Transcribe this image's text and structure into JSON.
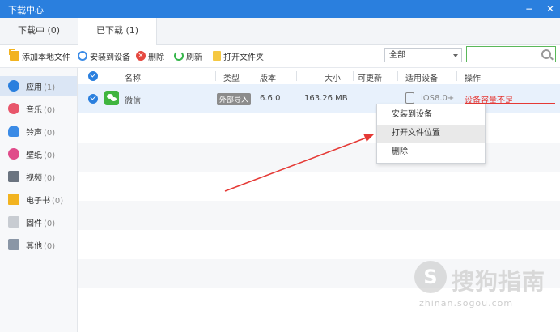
{
  "window": {
    "title": "下载中心",
    "minimize": "−",
    "close": "✕"
  },
  "tabs": [
    {
      "label": "下载中 (0)"
    },
    {
      "label": "已下载 (1)"
    }
  ],
  "toolbar": {
    "add_local": "添加本地文件",
    "install": "安装到设备",
    "delete": "删除",
    "refresh": "刷新",
    "open_folder": "打开文件夹"
  },
  "filter": {
    "value": "全部"
  },
  "search": {
    "placeholder": ""
  },
  "sidebar": {
    "items": [
      {
        "label": "应用",
        "count": "(1)"
      },
      {
        "label": "音乐",
        "count": "(0)"
      },
      {
        "label": "铃声",
        "count": "(0)"
      },
      {
        "label": "壁纸",
        "count": "(0)"
      },
      {
        "label": "视频",
        "count": "(0)"
      },
      {
        "label": "电子书",
        "count": "(0)"
      },
      {
        "label": "固件",
        "count": "(0)"
      },
      {
        "label": "其他",
        "count": "(0)"
      }
    ]
  },
  "table": {
    "headers": {
      "name": "名称",
      "type": "类型",
      "version": "版本",
      "size": "大小",
      "updatable": "可更新",
      "device": "适用设备",
      "action": "操作"
    },
    "rows": [
      {
        "name": "微信",
        "type": "外部导入",
        "version": "6.6.0",
        "size": "163.26 MB",
        "device": "iOS8.0+",
        "action": "设备容量不足"
      }
    ]
  },
  "context_menu": {
    "items": [
      {
        "label": "安装到设备"
      },
      {
        "label": "打开文件位置"
      },
      {
        "label": "删除"
      }
    ]
  },
  "watermark": {
    "logo": "S",
    "text": "搜狗指南",
    "url": "zhinan.sogou.com"
  },
  "colors": {
    "accent": "#2a7fde",
    "warning": "#e53935",
    "arrow": "#e53935"
  }
}
